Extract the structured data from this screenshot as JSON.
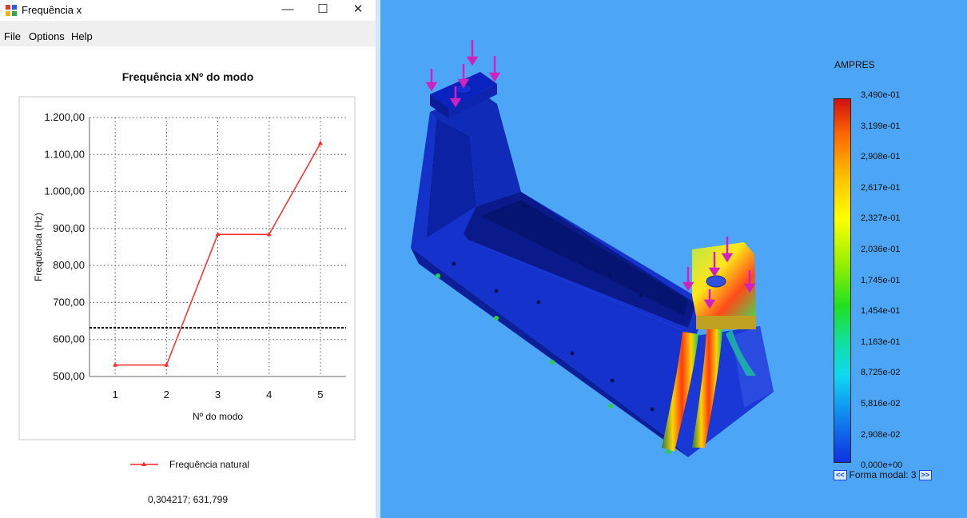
{
  "window": {
    "title": "Frequência x",
    "menu": [
      "File",
      "Options",
      "Help"
    ]
  },
  "chart_data": {
    "type": "line",
    "title": "Frequência xNº do modo",
    "xlabel": "Nº do modo",
    "ylabel": "Frequência (Hz)",
    "categories": [
      1,
      2,
      3,
      4,
      5
    ],
    "x": [
      1,
      2,
      3,
      4,
      5
    ],
    "y_ticks": [
      "500,00",
      "600,00",
      "700,00",
      "800,00",
      "900,00",
      "1.000,00",
      "1.100,00",
      "1.200,00"
    ],
    "ylim": [
      500,
      1200
    ],
    "xlim": [
      0.5,
      5.5
    ],
    "grid": true,
    "series": [
      {
        "name": "Frequência natural",
        "color": "#ff2a2a",
        "values": [
          531,
          531,
          884,
          884,
          1130
        ]
      }
    ],
    "reference_line": 631.799,
    "legend_position": "bottom"
  },
  "cursor_readout": "0,304217; 631,799",
  "results_panel": {
    "legend_title": "AMPRES",
    "colorbar_ticks": [
      "3,490e-01",
      "3,199e-01",
      "2,908e-01",
      "2,617e-01",
      "2,327e-01",
      "2,036e-01",
      "1,745e-01",
      "1,454e-01",
      "1,163e-01",
      "8,725e-02",
      "5,816e-02",
      "2,908e-02",
      "0,000e+00"
    ],
    "nav_prev": "<<",
    "nav_next": ">>",
    "modal_label": "Forma modal: 3",
    "colors": {
      "background": "#4da6f5",
      "model": "#1a2fd0",
      "load_arrow": "#d020c0"
    }
  }
}
